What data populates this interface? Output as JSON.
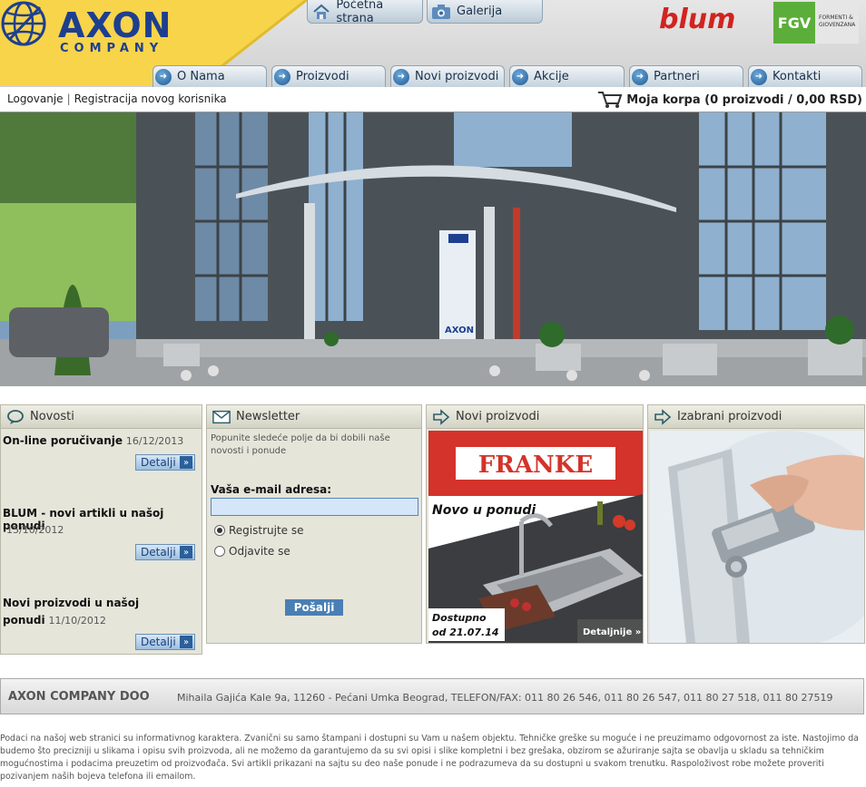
{
  "brand": {
    "logo_main": "AXON",
    "logo_sub": "COMPANY",
    "partner_blum": "blum",
    "partner_fgv": "FGV",
    "partner_fgv_text": "FORMENTI & GIOVENZANA"
  },
  "top_buttons": {
    "home": "Početna strana",
    "gallery": "Galerija"
  },
  "nav": {
    "items": [
      {
        "label": "O Nama"
      },
      {
        "label": "Proizvodi"
      },
      {
        "label": "Novi proizvodi"
      },
      {
        "label": "Akcije"
      },
      {
        "label": "Partneri"
      },
      {
        "label": "Kontakti"
      }
    ]
  },
  "account": {
    "login": "Logovanje",
    "register": "Registracija novog korisnika",
    "cart": "Moja korpa (0 proizvodi / 0,00 RSD)"
  },
  "banner": {
    "sign_text": "AXON"
  },
  "news": {
    "title": "Novosti",
    "items": [
      {
        "title": "On-line poručivanje",
        "date": "16/12/2013"
      },
      {
        "title": "BLUM - novi artikli u našoj ponudi",
        "date": "15/10/2012"
      },
      {
        "title_line1": "Novi proizvodi u našoj",
        "title_line2": "ponudi",
        "date": "11/10/2012"
      }
    ],
    "details_label": "Detalji"
  },
  "newsletter": {
    "title": "Newsletter",
    "intro": "Popunite sledeće polje da bi dobili naše novosti i ponude",
    "email_label": "Vaša e-mail adresa:",
    "email_value": "",
    "option_subscribe": "Registrujte se",
    "option_unsubscribe": "Odjavite se",
    "selected": "subscribe",
    "submit": "Pošalji"
  },
  "new_products": {
    "title": "Novi proizvodi",
    "brand": "FRANKE",
    "headline": "Novo u ponudi",
    "available_line1": "Dostupno",
    "available_line2": "od  21.07.14",
    "details": "Detaljnije »"
  },
  "featured": {
    "title": "Izabrani proizvodi"
  },
  "footer": {
    "company": "AXON COMPANY DOO",
    "address": "Mihaila Gajića Kale 9a,  11260 - Pećani Umka Beograd,  TELEFON/FAX: 011 80 26 546,  011 80 26 547,  011 80 27 518, 011 80 27519",
    "disclaimer": "Podaci na našoj web stranici su informativnog karaktera. Zvanični su samo štampani i dostupni su Vam u našem objektu. Tehničke greške su moguće i ne preuzimamo odgovornost za iste. Nastojimo da budemo što precizniji u slikama i opisu svih proizvoda, ali ne možemo da garantujemo da su svi opisi i slike kompletni i bez grešaka, obzirom se ažuriranje sajta se obavlja u skladu sa tehničkim mogućnostima i podacima preuzetim od proizvođača. Svi artikli prikazani na sajtu su deo naše ponude i ne podrazumeva da su dostupni u svakom trenutku. Raspoloživost robe možete proveriti pozivanjem naših bojeva telefona ili emailom."
  },
  "colors": {
    "brand_blue": "#1e3f8f",
    "logo_yellow": "#f7d44a",
    "blum_red": "#d2231e",
    "fgv_green": "#5cae3a",
    "franke_red": "#d3332a"
  }
}
